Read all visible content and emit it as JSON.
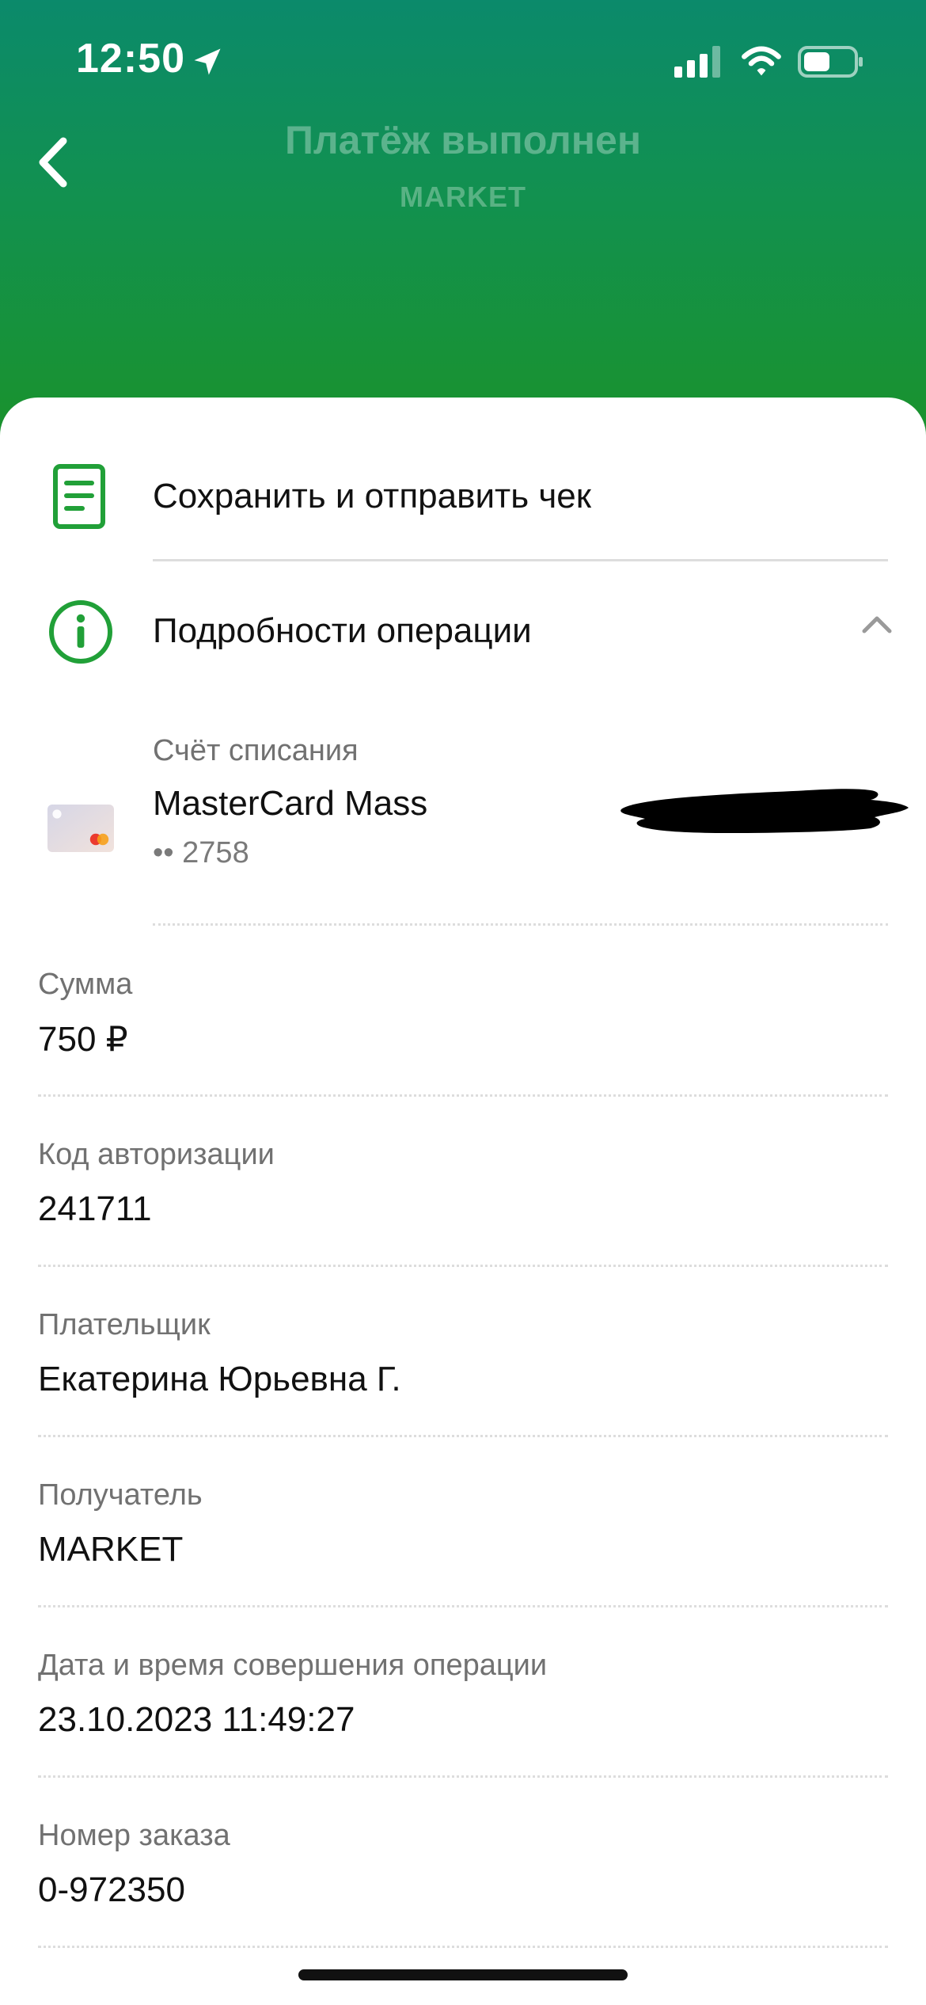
{
  "status_bar": {
    "time": "12:50"
  },
  "header": {
    "title": "Платёж выполнен",
    "subtitle": "MARKET"
  },
  "actions": {
    "save_receipt": "Сохранить и отправить чек",
    "details": "Подробности операции"
  },
  "account": {
    "label": "Счёт списания",
    "card_name": "MasterCard Mass",
    "card_number": "•• 2758"
  },
  "fields": [
    {
      "label": "Сумма",
      "value": "750 ₽"
    },
    {
      "label": "Код авторизации",
      "value": "241711"
    },
    {
      "label": "Плательщик",
      "value": "Екатерина Юрьевна Г."
    },
    {
      "label": "Получатель",
      "value": "MARKET"
    },
    {
      "label": "Дата и время совершения операции",
      "value": "23.10.2023 11:49:27"
    },
    {
      "label": "Номер заказа",
      "value": "0-972350"
    }
  ],
  "colors": {
    "header_top": "#0b8a6b",
    "header_bottom": "#1a922c",
    "accent_green": "#21a038"
  },
  "icons": [
    "location-arrow-icon",
    "signal-icon",
    "wifi-icon",
    "battery-icon",
    "back-chevron-icon",
    "receipt-icon",
    "info-icon",
    "chevron-up-icon",
    "bank-card-icon"
  ]
}
